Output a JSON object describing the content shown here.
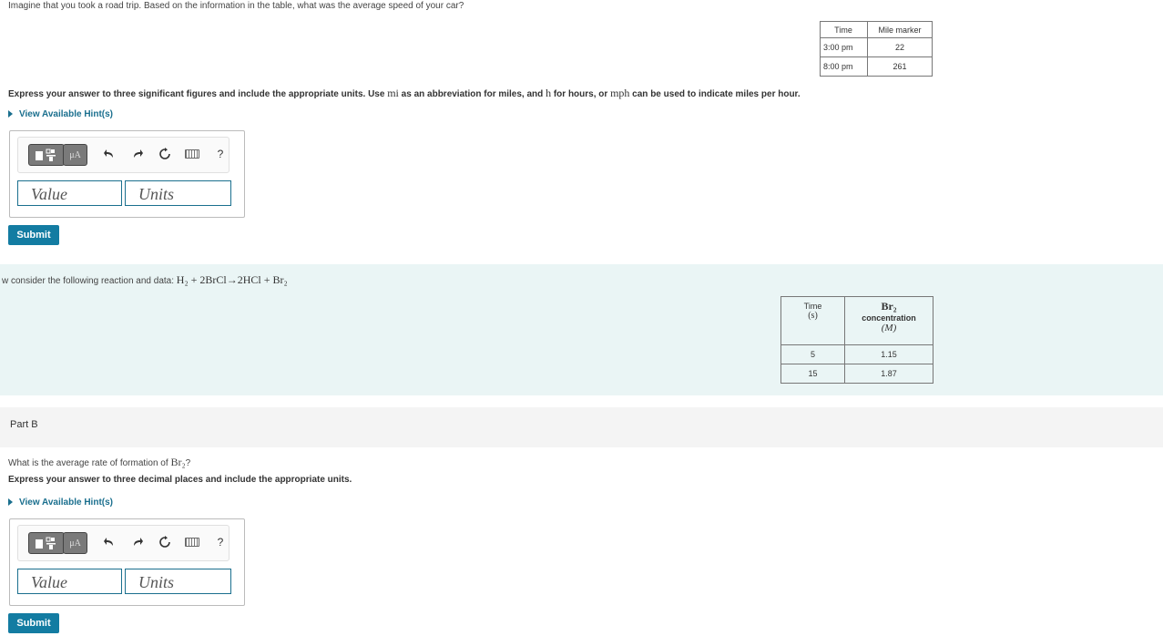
{
  "part_a": {
    "question": "Imagine that you took a road trip. Based on the information in the table, what was the average speed of your car?",
    "table": {
      "headers": [
        "Time",
        "Mile marker"
      ],
      "rows": [
        [
          "3:00 pm",
          "22"
        ],
        [
          "8:00 pm",
          "261"
        ]
      ]
    },
    "instructions": {
      "p1": "Express your answer to three significant figures and include the appropriate units. Use ",
      "mi": "mi",
      "p2": " as an abbreviation for miles, and ",
      "h": "h",
      "p3": " for hours, or ",
      "mph": "mph",
      "p4": " can be used to indicate miles per hour."
    },
    "hint_label": "View Available Hint(s)",
    "value_placeholder": "Value",
    "units_placeholder": "Units",
    "submit_label": "Submit"
  },
  "toolbar": {
    "mu_label": "μA",
    "help_label": "?"
  },
  "reaction": {
    "intro": "w consider the following reaction and data: ",
    "equation": "H₂ + 2BrCl→2HCl + Br₂",
    "table": {
      "h1_line1": "Time",
      "h1_line2": "(s)",
      "h2_line1": "Br₂",
      "h2_line2": "concentration",
      "h2_line3": "(M)",
      "rows": [
        [
          "5",
          "1.15"
        ],
        [
          "15",
          "1.87"
        ]
      ]
    }
  },
  "part_b": {
    "title": "Part B",
    "question_pre": "What is the average rate of formation of ",
    "question_chem": "Br₂",
    "question_post": "?",
    "instructions": "Express your answer to three decimal places and include the appropriate units.",
    "hint_label": "View Available Hint(s)",
    "value_placeholder": "Value",
    "units_placeholder": "Units",
    "submit_label": "Submit"
  },
  "colors": {
    "accent": "#137ca2",
    "link": "#1a6f8e",
    "band": "#eaf5f5"
  }
}
